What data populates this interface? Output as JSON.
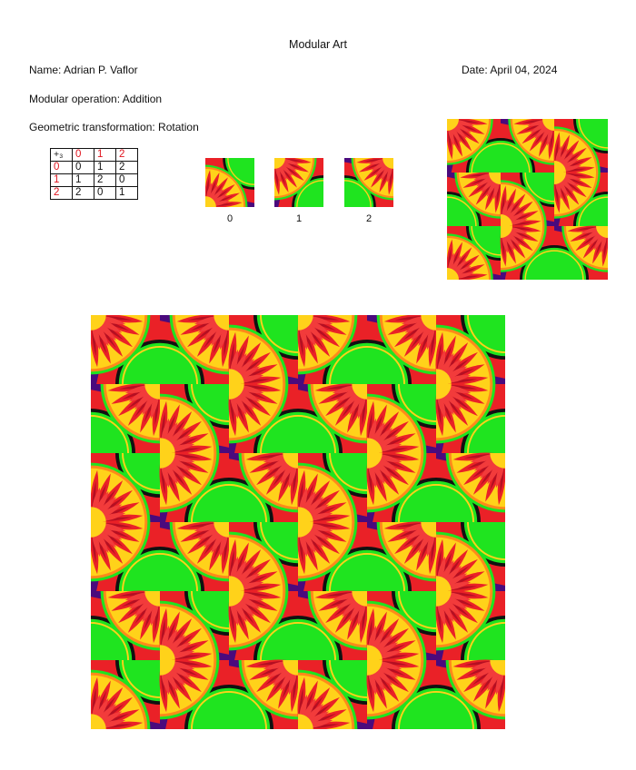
{
  "header": {
    "title": "Modular Art",
    "name": "Name: Adrian P. Vaflor",
    "date": "Date: April 04, 2024",
    "operation": "Modular operation: Addition",
    "transformation": "Geometric transformation: Rotation"
  },
  "cayley_table": {
    "operator": "+₃",
    "column_headers": [
      "0",
      "1",
      "2"
    ],
    "rows": [
      {
        "header": "0",
        "cells": [
          "0",
          "1",
          "2"
        ]
      },
      {
        "header": "1",
        "cells": [
          "1",
          "2",
          "0"
        ]
      },
      {
        "header": "2",
        "cells": [
          "2",
          "0",
          "1"
        ]
      }
    ]
  },
  "tiles": {
    "labels": [
      "0",
      "1",
      "2"
    ]
  },
  "artwork": {
    "preview_grid": [
      [
        1,
        2,
        0
      ],
      [
        2,
        0,
        1
      ],
      [
        0,
        1,
        2
      ]
    ],
    "main_grid": [
      [
        1,
        2,
        0,
        1,
        2,
        0
      ],
      [
        2,
        0,
        1,
        2,
        0,
        1
      ],
      [
        0,
        1,
        2,
        0,
        1,
        2
      ],
      [
        1,
        2,
        0,
        1,
        2,
        0
      ],
      [
        2,
        0,
        1,
        2,
        0,
        1
      ],
      [
        0,
        1,
        2,
        0,
        1,
        2
      ]
    ]
  },
  "colors": {
    "red": "#ea2127",
    "green": "#1fe41f",
    "purple": "#4a0a7d",
    "yellow": "#ffd21a",
    "orange": "#ff8a1a",
    "dark_red": "#b50f22",
    "black": "#111111"
  }
}
